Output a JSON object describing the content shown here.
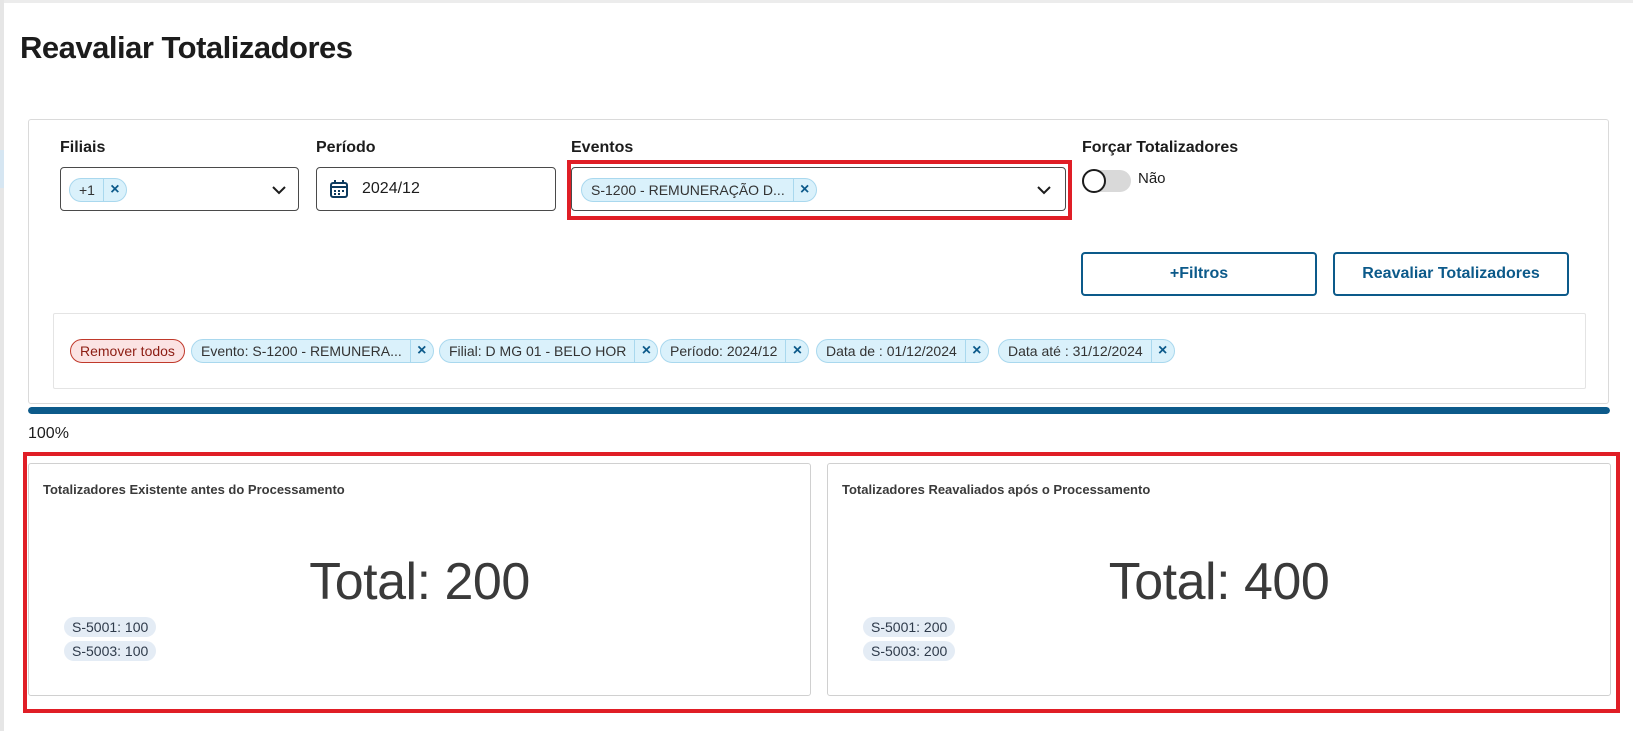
{
  "page": {
    "title": "Reavaliar Totalizadores"
  },
  "filters": {
    "filiais": {
      "label": "Filiais",
      "chip": "+1",
      "remove_symbol": "×"
    },
    "periodo": {
      "label": "Período",
      "value": "2024/12"
    },
    "eventos": {
      "label": "Eventos",
      "chip": "S-1200 - REMUNERAÇÃO D...",
      "remove_symbol": "×"
    },
    "forcar": {
      "label": "Forçar Totalizadores",
      "toggle_value": "Não",
      "toggle_on": false
    }
  },
  "actions": {
    "more_filters": "+Filtros",
    "reevaluate": "Reavaliar Totalizadores"
  },
  "disclaimers": {
    "remove_all": "Remover todos",
    "items": [
      {
        "label": "Evento: S-1200 - REMUNERA..."
      },
      {
        "label": "Filial: D MG 01 - BELO HOR"
      },
      {
        "label": "Período: 2024/12"
      },
      {
        "label": "Data de : 01/12/2024"
      },
      {
        "label": "Data até : 31/12/2024"
      }
    ],
    "remove_symbol": "×"
  },
  "progress": {
    "percent": 100,
    "text": "100%"
  },
  "cards": [
    {
      "title": "Totalizadores Existente antes do Processamento",
      "total": "Total: 200",
      "tags": [
        "S-5001: 100",
        "S-5003: 100"
      ]
    },
    {
      "title": "Totalizadores Reavaliados após o Processamento",
      "total": "Total: 400",
      "tags": [
        "S-5001: 200",
        "S-5003: 200"
      ]
    }
  ],
  "colors": {
    "primary": "#0c5a8a",
    "highlight": "#e01e26",
    "chip_bg": "#daf1fb",
    "danger_chip_bg": "#fbe3e3"
  },
  "icons": {
    "chevron": "chevron-down-icon",
    "calendar": "calendar-icon",
    "close": "close-icon"
  }
}
